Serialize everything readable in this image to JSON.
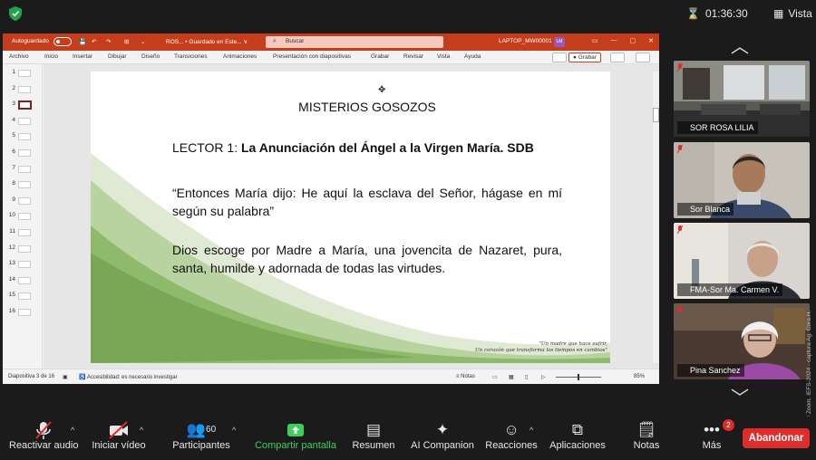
{
  "top": {
    "timer": "01:36:30",
    "view_label": "Vista"
  },
  "ppt": {
    "autosave_label": "Autoguardado",
    "doc_title": "ROS... • Guardado en Este... ∨",
    "search_placeholder": "Buscar",
    "device_label": "LAPTOP_MW00001",
    "avatar_initials": "LM",
    "menu": [
      "Archivo",
      "Inicio",
      "Insertar",
      "Dibujar",
      "Diseño",
      "Transiciones",
      "Animaciones",
      "Presentación con diapositivas",
      "Grabar",
      "Revisar",
      "Vista",
      "Ayuda"
    ],
    "record_label": "Grabar",
    "thumbnails": [
      "1",
      "2",
      "3",
      "4",
      "5",
      "6",
      "7",
      "8",
      "9",
      "10",
      "11",
      "12",
      "13",
      "14",
      "15",
      "16"
    ],
    "selected_thumbnail": 3,
    "status": {
      "slide_count": "Diapositiva 3 de 16",
      "accessibility": "Accesibilidad: es necesario investigar",
      "notes": "Notas",
      "zoom": "85%"
    }
  },
  "slide": {
    "title": "MISTERIOS GOSOZOS",
    "lector_prefix": "LECTOR 1: ",
    "lector_bold": "La Anunciación del Ángel a la Virgen María. SDB",
    "quote": "“Entonces María dijo: He aquí la esclava del Señor, hágase en mí según su palabra”",
    "body": "Dios escoge por Madre a María, una jovencita de Nazaret, pura, santa, humilde y adornada de todas las virtudes.",
    "motto_line1": "\"Un madre que hace sufrir,",
    "motto_line2": "Un corazón que transforma los tiempos en cambios\""
  },
  "participants": [
    {
      "name": "SOR ROSA LILIA"
    },
    {
      "name": "Sor Blanca"
    },
    {
      "name": "FMA-Sor Ma. Carmen V."
    },
    {
      "name": "Pina Sanchez"
    }
  ],
  "credit": "Cortesía © Zoom. IEFS-2024 - captura Ag. Cora.H.",
  "toolbar": {
    "audio": "Reactivar audio",
    "video": "Iniciar vídeo",
    "participants": "Participantes",
    "participants_count": "60",
    "share": "Compartir pantalla",
    "summary": "Resumen",
    "companion": "AI Companion",
    "reactions": "Reacciones",
    "apps": "Aplicaciones",
    "notes": "Notas",
    "more": "Más",
    "more_badge": "2",
    "leave": "Abandonar"
  },
  "colors": {
    "ppt_accent": "#c43e1c",
    "share_green": "#3ccf5a",
    "leave_red": "#e02b2b",
    "slide_green": "#7fae5e"
  }
}
